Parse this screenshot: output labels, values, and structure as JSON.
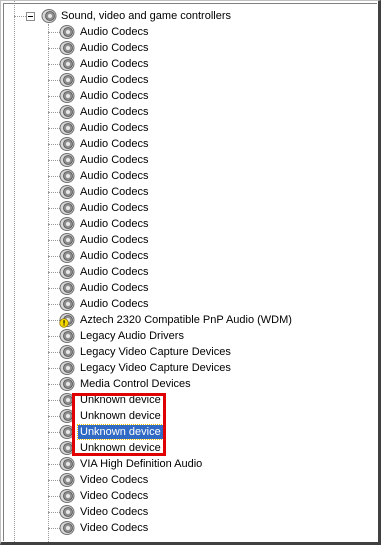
{
  "tree": {
    "category_label": "Sound, video and game controllers",
    "items": [
      {
        "label": "Audio Codecs",
        "icon": "speaker-icon"
      },
      {
        "label": "Audio Codecs",
        "icon": "speaker-icon"
      },
      {
        "label": "Audio Codecs",
        "icon": "speaker-icon"
      },
      {
        "label": "Audio Codecs",
        "icon": "speaker-icon"
      },
      {
        "label": "Audio Codecs",
        "icon": "speaker-icon"
      },
      {
        "label": "Audio Codecs",
        "icon": "speaker-icon"
      },
      {
        "label": "Audio Codecs",
        "icon": "speaker-icon"
      },
      {
        "label": "Audio Codecs",
        "icon": "speaker-icon"
      },
      {
        "label": "Audio Codecs",
        "icon": "speaker-icon"
      },
      {
        "label": "Audio Codecs",
        "icon": "speaker-icon"
      },
      {
        "label": "Audio Codecs",
        "icon": "speaker-icon"
      },
      {
        "label": "Audio Codecs",
        "icon": "speaker-icon"
      },
      {
        "label": "Audio Codecs",
        "icon": "speaker-icon"
      },
      {
        "label": "Audio Codecs",
        "icon": "speaker-icon"
      },
      {
        "label": "Audio Codecs",
        "icon": "speaker-icon"
      },
      {
        "label": "Audio Codecs",
        "icon": "speaker-icon"
      },
      {
        "label": "Audio Codecs",
        "icon": "speaker-icon"
      },
      {
        "label": "Audio Codecs",
        "icon": "speaker-icon"
      },
      {
        "label": "Aztech 2320 Compatible PnP Audio (WDM)",
        "icon": "speaker-warning-icon"
      },
      {
        "label": "Legacy Audio Drivers",
        "icon": "speaker-icon"
      },
      {
        "label": "Legacy Video Capture Devices",
        "icon": "speaker-icon"
      },
      {
        "label": "Legacy Video Capture Devices",
        "icon": "speaker-icon"
      },
      {
        "label": "Media Control Devices",
        "icon": "speaker-icon"
      },
      {
        "label": "Unknown device",
        "icon": "speaker-icon"
      },
      {
        "label": "Unknown device",
        "icon": "speaker-icon"
      },
      {
        "label": "Unknown device",
        "icon": "speaker-icon",
        "selected": true
      },
      {
        "label": "Unknown device",
        "icon": "speaker-icon"
      },
      {
        "label": "VIA High Definition Audio",
        "icon": "speaker-icon"
      },
      {
        "label": "Video Codecs",
        "icon": "speaker-icon"
      },
      {
        "label": "Video Codecs",
        "icon": "speaker-icon"
      },
      {
        "label": "Video Codecs",
        "icon": "speaker-icon"
      },
      {
        "label": "Video Codecs",
        "icon": "speaker-icon"
      }
    ]
  },
  "colors": {
    "selection": "#316ac5",
    "annotation_box": "#e00000",
    "warning": "#f5d800"
  }
}
